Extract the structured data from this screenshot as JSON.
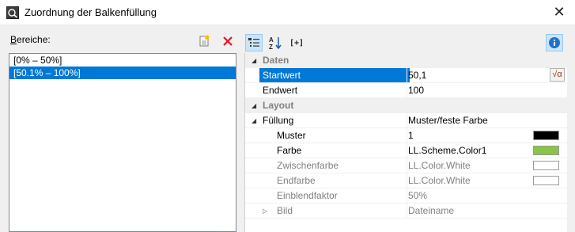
{
  "window": {
    "title": "Zuordnung der Balkenfüllung"
  },
  "left": {
    "label_accesskey": "B",
    "label_rest": "ereiche:",
    "items": [
      "[0% – 50%]",
      "[50.1% – 100%]"
    ],
    "selected_index": 1
  },
  "icons": {
    "new": "new-document-icon",
    "delete": "delete-x-icon",
    "categorized": "categorized-view-icon",
    "sort": "sort-az-icon",
    "expand": "expand-all-icon",
    "info": "info-icon"
  },
  "right_toolbar": {
    "expand_label": "[+]"
  },
  "grid": {
    "rows": [
      {
        "type": "cat",
        "label": "Daten"
      },
      {
        "type": "prop",
        "label": "Startwert",
        "value": "50,1",
        "selected": true,
        "formula": "√α"
      },
      {
        "type": "prop",
        "label": "Endwert",
        "value": "100"
      },
      {
        "type": "cat",
        "label": "Layout"
      },
      {
        "type": "prop",
        "label": "Füllung",
        "value": "Muster/feste Farbe",
        "indent": 1
      },
      {
        "type": "prop",
        "label": "Muster",
        "value": "1",
        "indent": 2,
        "swatch": "#000000"
      },
      {
        "type": "prop",
        "label": "Farbe",
        "value": "LL.Scheme.Color1",
        "indent": 2,
        "swatch": "#8bc34a"
      },
      {
        "type": "prop",
        "label": "Zwischenfarbe",
        "value": "LL.Color.White",
        "indent": 2,
        "swatch": "#ffffff",
        "disabled": true
      },
      {
        "type": "prop",
        "label": "Endfarbe",
        "value": "LL.Color.White",
        "indent": 2,
        "swatch": "#ffffff",
        "disabled": true
      },
      {
        "type": "prop",
        "label": "Einblendfaktor",
        "value": "50%",
        "indent": 2,
        "disabled": true
      },
      {
        "type": "prop",
        "label": "Bild",
        "value": "Dateiname",
        "indent": 2,
        "disabled": true,
        "expander": true
      }
    ]
  },
  "colors": {
    "selection": "#0078d7",
    "delete": "#e81123",
    "info": "#1e73c8"
  }
}
